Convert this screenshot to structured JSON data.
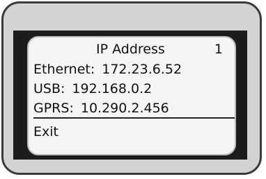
{
  "screen": {
    "title": "IP Address",
    "page_number": "1",
    "rows": [
      {
        "label": "Ethernet:",
        "value": "172.23.6.52"
      },
      {
        "label": "USB:",
        "value": "192.168.0.2"
      },
      {
        "label": "GPRS:",
        "value": "10.290.2.456"
      }
    ],
    "exit_label": "Exit"
  }
}
